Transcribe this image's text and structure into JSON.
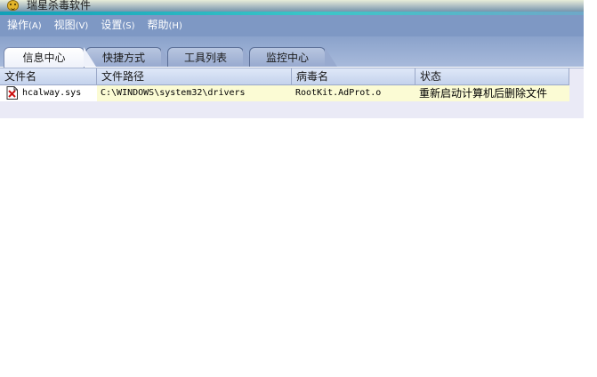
{
  "window": {
    "title": "瑞星杀毒软件"
  },
  "menu": [
    {
      "label": "操作",
      "hotkey": "(A)"
    },
    {
      "label": "视图",
      "hotkey": "(V)"
    },
    {
      "label": "设置",
      "hotkey": "(S)"
    },
    {
      "label": "帮助",
      "hotkey": "(H)"
    }
  ],
  "tabs": [
    {
      "label": "信息中心",
      "active": true
    },
    {
      "label": "快捷方式",
      "active": false
    },
    {
      "label": "工具列表",
      "active": false
    },
    {
      "label": "监控中心",
      "active": false
    }
  ],
  "table": {
    "columns": [
      "文件名",
      "文件路径",
      "病毒名",
      "状态"
    ],
    "rows": [
      {
        "filename": "hcalway.sys",
        "path": "C:\\WINDOWS\\system32\\drivers",
        "virus": "RootKit.AdProt.o",
        "status": "重新启动计算机后删除文件"
      }
    ]
  },
  "colors": {
    "menubar": "#7e98c4",
    "accent": "#11a0b8",
    "row_highlight": "#fbfbd4"
  },
  "icons": {
    "app": "rising-lion-icon",
    "file": "infected-file-icon"
  }
}
